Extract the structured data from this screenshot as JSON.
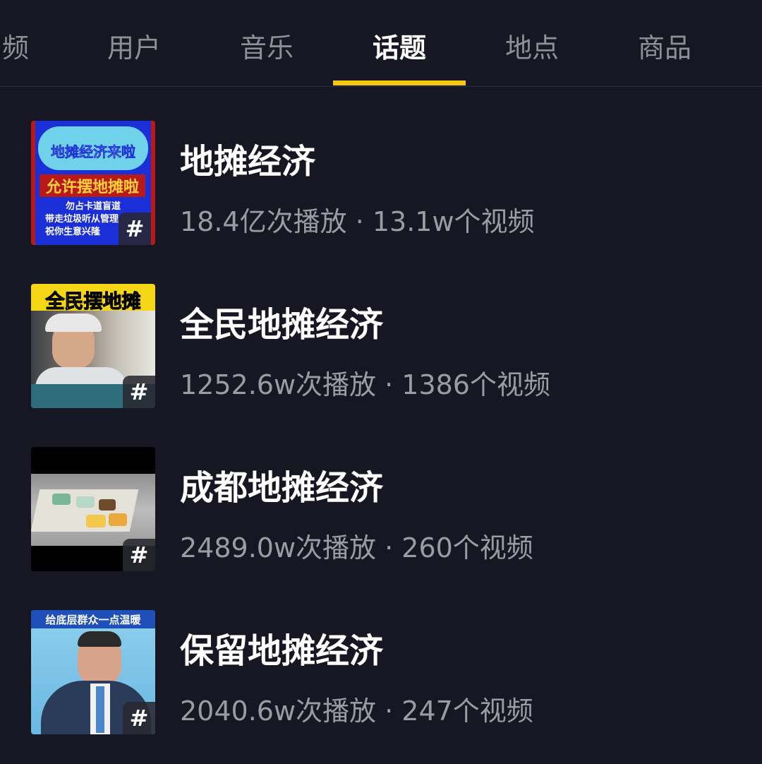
{
  "tabs": [
    {
      "label": "频",
      "active": false
    },
    {
      "label": "用户",
      "active": false
    },
    {
      "label": "音乐",
      "active": false
    },
    {
      "label": "话题",
      "active": true
    },
    {
      "label": "地点",
      "active": false
    },
    {
      "label": "商品",
      "active": false
    }
  ],
  "accent_color": "#f9c711",
  "hash_symbol": "#",
  "results": [
    {
      "title": "地摊经济",
      "stats": "18.4亿次播放 · 13.1w个视频",
      "thumb_text": [
        "地摊经济来啦",
        "允许摆地摊啦",
        "勿占卡道盲道",
        "带走垃圾听从管理",
        "祝你生意兴隆"
      ]
    },
    {
      "title": "全民地摊经济",
      "stats": "1252.6w次播放 · 1386个视频",
      "thumb_text": [
        "全民摆地摊"
      ]
    },
    {
      "title": "成都地摊经济",
      "stats": "2489.0w次播放 · 260个视频",
      "thumb_text": []
    },
    {
      "title": "保留地摊经济",
      "stats": "2040.6w次播放 · 247个视频",
      "thumb_text": [
        "给底层群众一点温暖"
      ]
    }
  ]
}
